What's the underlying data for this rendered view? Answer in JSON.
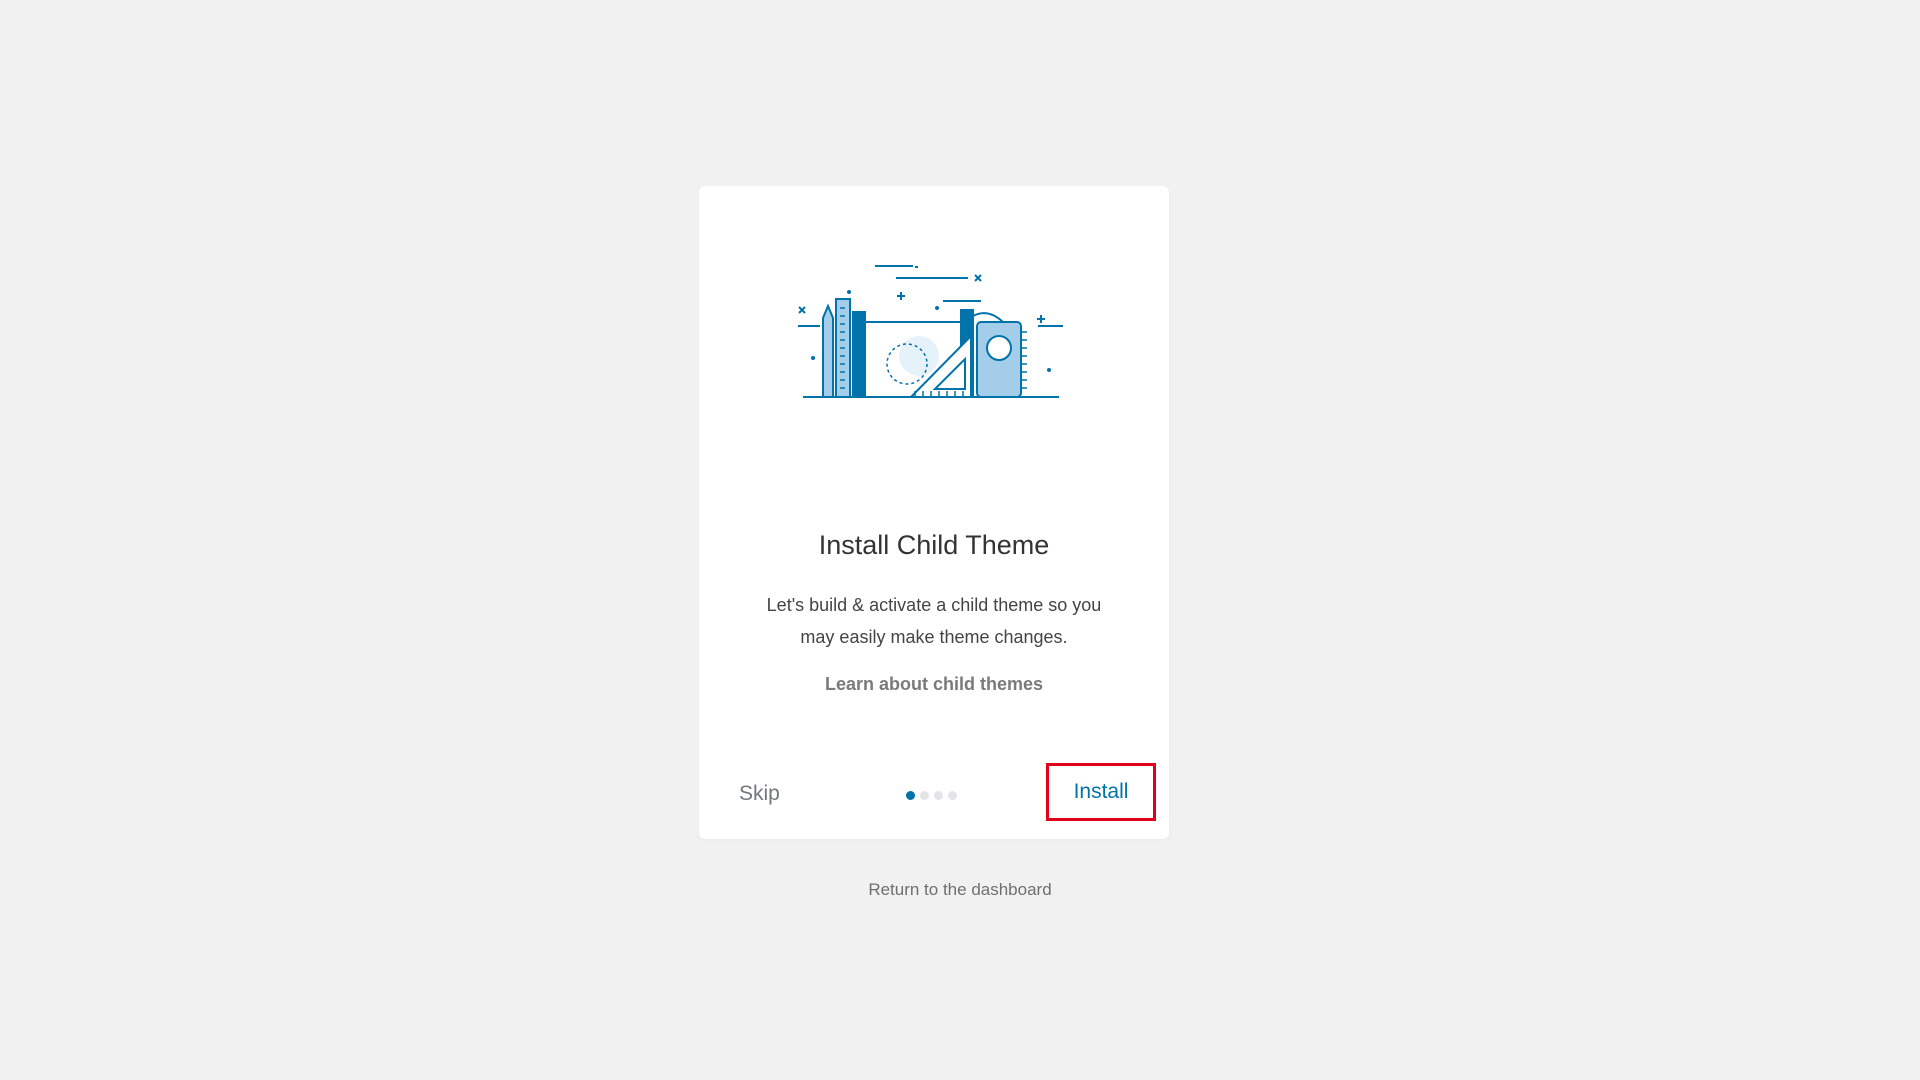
{
  "card": {
    "title": "Install Child Theme",
    "description": "Let's build & activate a child theme so you may easily make theme changes.",
    "learn_link": "Learn about child themes",
    "skip_label": "Skip",
    "install_label": "Install",
    "progress": {
      "total_steps": 4,
      "current_step": 1
    },
    "illustration": "stationery-illustration"
  },
  "footer": {
    "return_link": "Return to the dashboard"
  },
  "colors": {
    "accent": "#0073aa",
    "highlight_border": "#e3001b",
    "background": "#f1f1f1"
  }
}
